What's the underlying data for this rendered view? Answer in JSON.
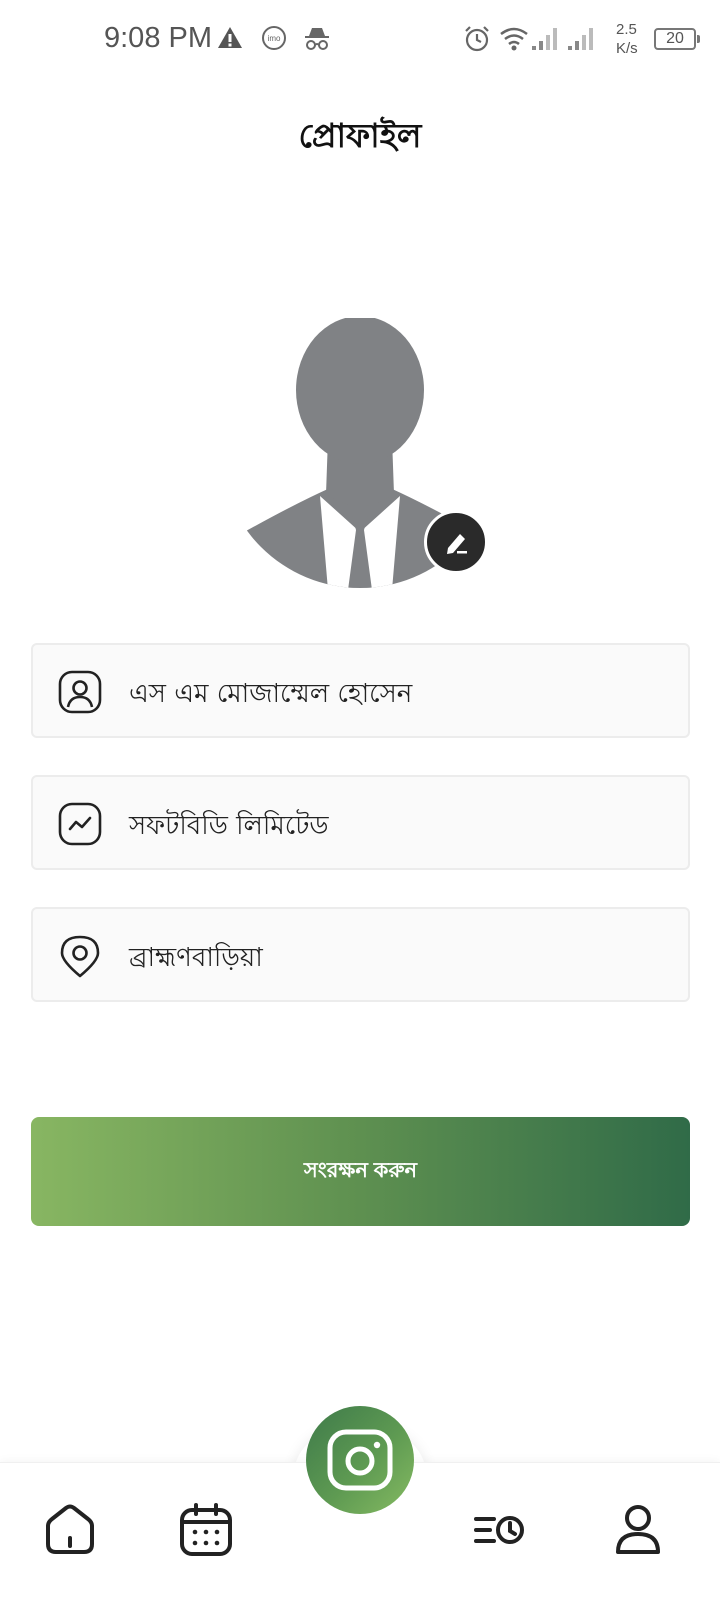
{
  "status_bar": {
    "time": "9:08 PM",
    "net_speed_value": "2.5",
    "net_speed_unit": "K/s",
    "battery": "20",
    "icons": [
      "warning-icon",
      "imo-icon",
      "incognito-icon",
      "alarm-icon",
      "wifi-icon",
      "signal-icon",
      "signal-icon"
    ]
  },
  "header": {
    "title": "প্রোফাইল"
  },
  "profile": {
    "avatar_icon": "person-silhouette",
    "edit_icon": "pencil-icon"
  },
  "fields": {
    "name": {
      "value": "এস এম মোজাম্মেল হোসেন",
      "icon": "user-icon"
    },
    "company": {
      "value": "সফটবিডি লিমিটেড",
      "icon": "activity-icon"
    },
    "location": {
      "value": "ব্রাহ্মণবাড়িয়া",
      "icon": "location-pin-icon"
    }
  },
  "actions": {
    "save_label": "সংরক্ষন করুন"
  },
  "bottom_nav": {
    "items": [
      "home-icon",
      "calendar-icon",
      "camera-icon",
      "history-icon",
      "profile-icon"
    ]
  },
  "colors": {
    "accent_start": "#88b662",
    "accent_end": "#306b48",
    "avatar_gray": "#808285"
  }
}
